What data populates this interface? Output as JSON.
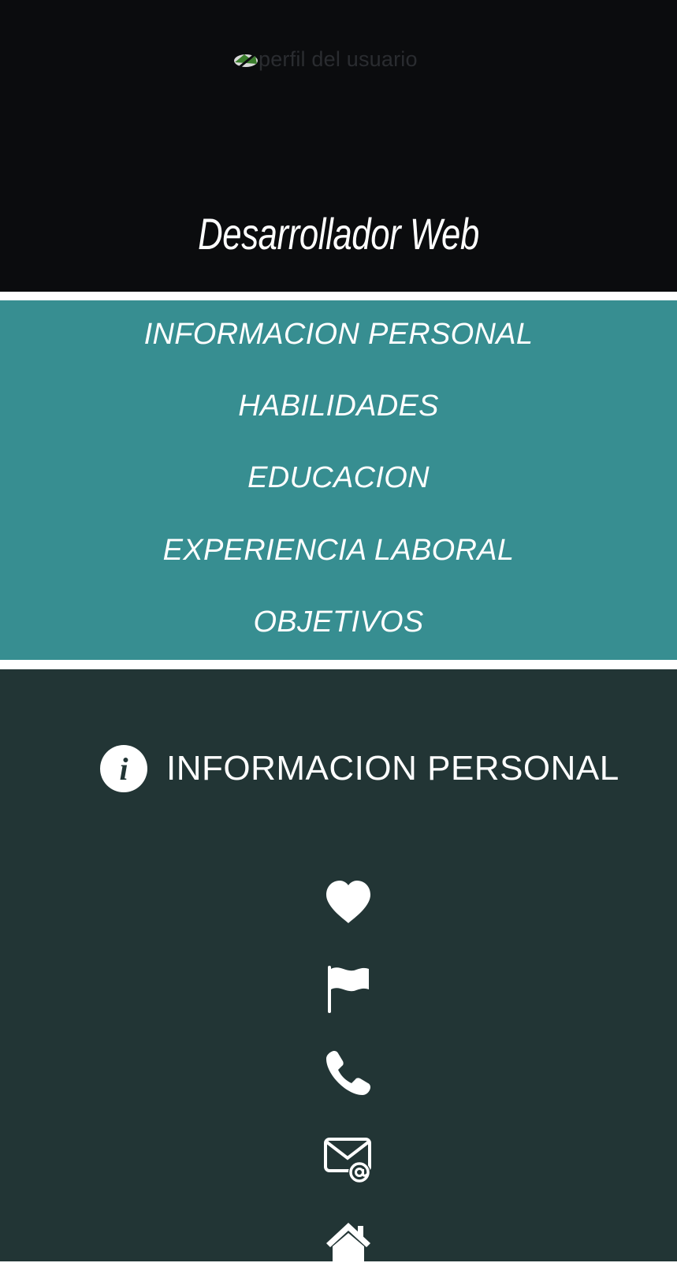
{
  "header": {
    "avatar_alt": "perfil del usuario",
    "role": "Desarrollador Web"
  },
  "nav": {
    "items": [
      {
        "label": "INFORMACION PERSONAL"
      },
      {
        "label": "HABILIDADES"
      },
      {
        "label": "EDUCACION"
      },
      {
        "label": "EXPERIENCIA LABORAL"
      },
      {
        "label": "OBJETIVOS"
      }
    ]
  },
  "section": {
    "title": "INFORMACION PERSONAL",
    "icon_glyph": "i",
    "icon": "info-circle-icon"
  },
  "details": {
    "icons": [
      "heart-icon",
      "flag-icon",
      "phone-icon",
      "envelope-at-icon",
      "home-icon"
    ]
  },
  "colors": {
    "header_bg": "#0b0c0e",
    "nav_bg": "#378e91",
    "content_bg": "#223535",
    "text": "#ffffff"
  }
}
